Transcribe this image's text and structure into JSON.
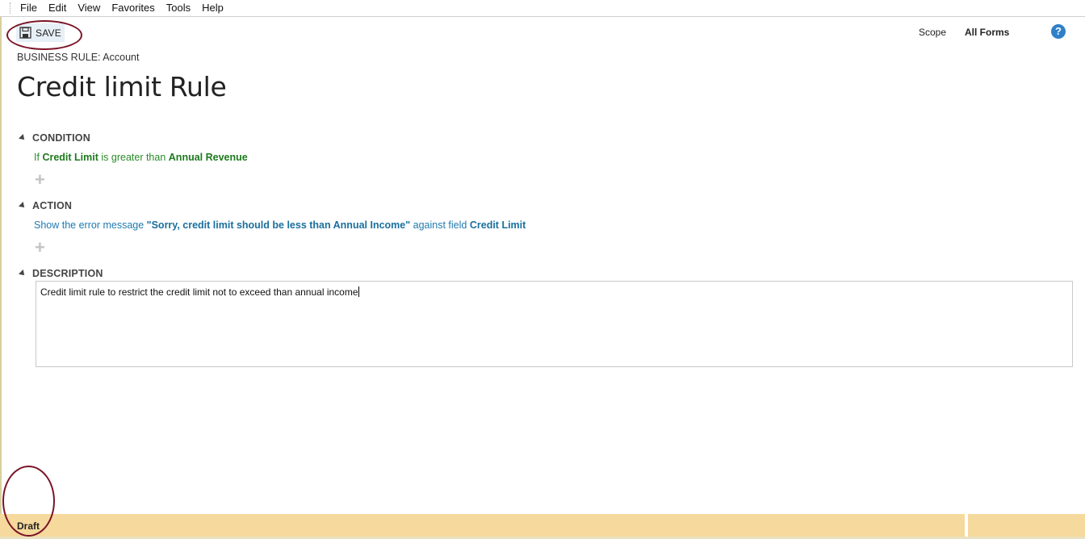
{
  "menu": {
    "items": [
      "File",
      "Edit",
      "View",
      "Favorites",
      "Tools",
      "Help"
    ]
  },
  "toolbar": {
    "save_label": "SAVE",
    "save_icon": "floppy-disk-icon"
  },
  "scope": {
    "label": "Scope",
    "value": "All Forms"
  },
  "help": {
    "icon": "help-icon",
    "glyph": "?"
  },
  "rule": {
    "entity_line": "BUSINESS RULE: Account",
    "title": "Credit limit Rule"
  },
  "condition": {
    "header": "CONDITION",
    "prefix": "If",
    "field": "Credit Limit",
    "operator": "is greater than",
    "value": "Annual Revenue",
    "add_glyph": "+"
  },
  "action": {
    "header": "ACTION",
    "prefix": "Show the error message",
    "message": "\"Sorry, credit limit should be less than Annual Income\"",
    "middle": "against field",
    "field": "Credit Limit",
    "add_glyph": "+"
  },
  "description": {
    "header": "DESCRIPTION",
    "text": "Credit limit rule to restrict the credit limit not to exceed than annual income"
  },
  "status": {
    "text": "Draft"
  },
  "colors": {
    "condition_green": "#1d7a1d",
    "action_blue": "#1a6f9e",
    "status_bar": "#f6d99c",
    "annotation_oval": "#7b1426",
    "help_blue": "#2f80c8"
  }
}
